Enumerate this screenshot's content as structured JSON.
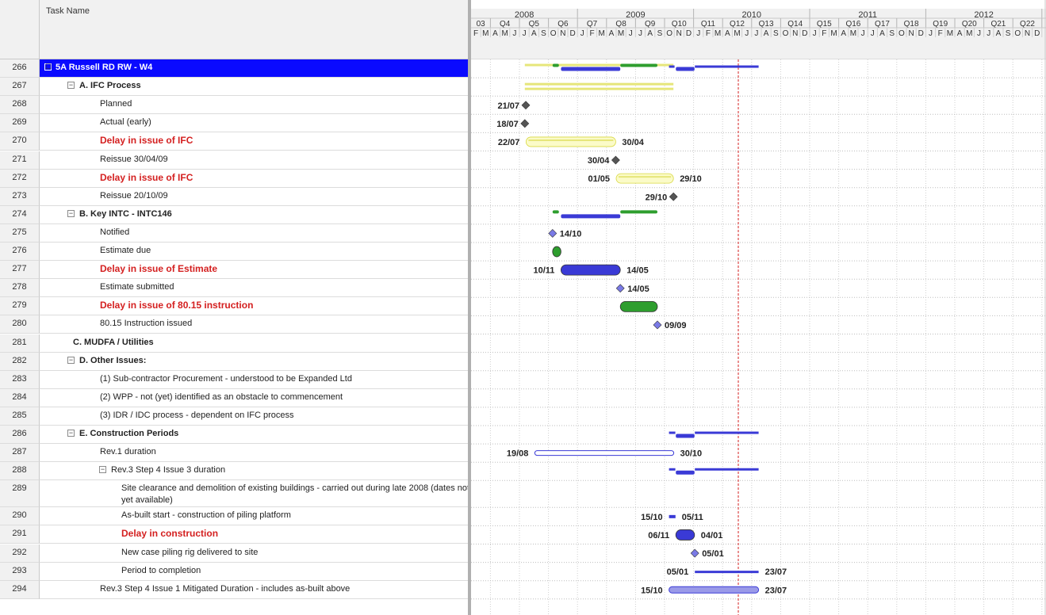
{
  "table": {
    "header": {
      "task_name": "Task Name"
    },
    "rows": [
      {
        "id": "266",
        "name": "5A Russell RD RW - W4",
        "style": "selected",
        "toggle": "☐"
      },
      {
        "id": "267",
        "name": "A. IFC Process",
        "style": "bold",
        "toggle": "−"
      },
      {
        "id": "268",
        "name": "Planned",
        "style": "normal"
      },
      {
        "id": "269",
        "name": "Actual (early)",
        "style": "normal"
      },
      {
        "id": "270",
        "name": "Delay in issue of IFC",
        "style": "red"
      },
      {
        "id": "271",
        "name": "Reissue 30/04/09",
        "style": "normal"
      },
      {
        "id": "272",
        "name": "Delay in issue of IFC",
        "style": "red"
      },
      {
        "id": "273",
        "name": "Reissue 20/10/09",
        "style": "normal"
      },
      {
        "id": "274",
        "name": "B. Key INTC - INTC146",
        "style": "bold",
        "toggle": "−"
      },
      {
        "id": "275",
        "name": "Notified",
        "style": "normal"
      },
      {
        "id": "276",
        "name": "Estimate due",
        "style": "normal"
      },
      {
        "id": "277",
        "name": "Delay in issue of Estimate",
        "style": "red"
      },
      {
        "id": "278",
        "name": "Estimate submitted",
        "style": "normal"
      },
      {
        "id": "279",
        "name": "Delay in issue of 80.15 instruction",
        "style": "red"
      },
      {
        "id": "280",
        "name": "80.15 Instruction issued",
        "style": "normal"
      },
      {
        "id": "281",
        "name": "C. MUDFA / Utilities",
        "style": "bold"
      },
      {
        "id": "282",
        "name": "D. Other Issues:",
        "style": "bold",
        "toggle": "−"
      },
      {
        "id": "283",
        "name": "(1) Sub-contractor Procurement - understood to be Expanded Ltd",
        "style": "normal"
      },
      {
        "id": "284",
        "name": "(2) WPP - not (yet) identified as an obstacle to commencement",
        "style": "normal"
      },
      {
        "id": "285",
        "name": "(3) IDR / IDC process - dependent on IFC process",
        "style": "normal"
      },
      {
        "id": "286",
        "name": "E. Construction Periods",
        "style": "bold",
        "toggle": "−"
      },
      {
        "id": "287",
        "name": "Rev.1 duration",
        "style": "normal"
      },
      {
        "id": "288",
        "name": "Rev.3 Step 4 Issue 3 duration",
        "style": "normal",
        "toggle": "−"
      },
      {
        "id": "289",
        "name": "Site clearance and demolition of existing buildings - carried out during late 2008 (dates not yet available)",
        "style": "wrap"
      },
      {
        "id": "290",
        "name": "As-built start - construction of piling platform",
        "style": "normal"
      },
      {
        "id": "291",
        "name": "Delay in construction",
        "style": "red"
      },
      {
        "id": "292",
        "name": "New case piling rig delivered to site",
        "style": "normal"
      },
      {
        "id": "293",
        "name": "Period to completion",
        "style": "normal"
      },
      {
        "id": "294",
        "name": "Rev.3 Step 4 Issue 1 Mitigated Duration - includes as-built above",
        "style": "normal"
      }
    ]
  },
  "timescale": {
    "years": [
      "2008",
      "2009",
      "2010",
      "2011",
      "2012"
    ],
    "quarters": [
      "Q3",
      "Q4",
      "Q5",
      "Q6",
      "Q7",
      "Q8",
      "Q9",
      "Q10",
      "Q11",
      "Q12",
      "Q13",
      "Q14",
      "Q15",
      "Q16",
      "Q17",
      "Q18",
      "Q19",
      "Q20",
      "Q21",
      "Q22"
    ],
    "first_quarter_display": "03",
    "month_letters": "FMAMJJASONDJFMAMJJASONDJFMAMJJASONDJFMAMJJASONDJFMAMJJASOND"
  },
  "colors": {
    "selected_row": "#0a0aff",
    "blue_bar": "#3a3ad6",
    "green_bar": "#2e9e2e",
    "yellow_bar": "#e6e67a",
    "milestone": "#555555",
    "milestone_blue": "#7a7ae6",
    "status_line": "#d42020",
    "delay_text": "#d42020"
  },
  "gantt": {
    "items": [
      {
        "row": 0,
        "kind": "summary-set"
      },
      {
        "row": 1,
        "kind": "summary-yellow"
      },
      {
        "row": 2,
        "kind": "milestone",
        "color": "dark",
        "date": "2008-07-21",
        "left_label": "21/07"
      },
      {
        "row": 3,
        "kind": "milestone",
        "color": "dark",
        "date": "2008-07-18",
        "left_label": "18/07"
      },
      {
        "row": 4,
        "kind": "bar",
        "color": "yellow",
        "start": "2008-07-22",
        "end": "2009-04-30",
        "left_label": "22/07",
        "right_label": "30/04"
      },
      {
        "row": 5,
        "kind": "milestone",
        "color": "dark",
        "date": "2009-04-30",
        "left_label": "30/04"
      },
      {
        "row": 6,
        "kind": "bar",
        "color": "yellow",
        "start": "2009-05-01",
        "end": "2009-10-29",
        "left_label": "01/05",
        "right_label": "29/10"
      },
      {
        "row": 7,
        "kind": "milestone",
        "color": "dark",
        "date": "2009-10-29",
        "left_label": "29/10"
      },
      {
        "row": 8,
        "kind": "summary-b"
      },
      {
        "row": 9,
        "kind": "milestone",
        "color": "blue",
        "date": "2008-10-14",
        "right_label": "14/10"
      },
      {
        "row": 10,
        "kind": "bar",
        "color": "green",
        "start": "2008-10-14",
        "end": "2008-11-10"
      },
      {
        "row": 11,
        "kind": "bar",
        "color": "blue",
        "start": "2008-11-10",
        "end": "2009-05-14",
        "left_label": "10/11",
        "right_label": "14/05"
      },
      {
        "row": 12,
        "kind": "milestone",
        "color": "blue",
        "date": "2009-05-14",
        "right_label": "14/05"
      },
      {
        "row": 13,
        "kind": "bar",
        "color": "green",
        "start": "2009-05-14",
        "end": "2009-09-09"
      },
      {
        "row": 14,
        "kind": "milestone",
        "color": "blue",
        "date": "2009-09-09",
        "right_label": "09/09"
      },
      {
        "row": 20,
        "kind": "summary-e"
      },
      {
        "row": 21,
        "kind": "outline-bar",
        "start": "2008-08-19",
        "end": "2009-10-30",
        "left_label": "19/08",
        "right_label": "30/10"
      },
      {
        "row": 22,
        "kind": "summary-e"
      },
      {
        "row": 24,
        "kind": "bar-thin",
        "color": "blue",
        "start": "2009-10-15",
        "end": "2009-11-05",
        "left_label": "15/10",
        "right_label": "05/11"
      },
      {
        "row": 25,
        "kind": "bar",
        "color": "blue",
        "start": "2009-11-06",
        "end": "2010-01-04",
        "left_label": "06/11",
        "right_label": "04/01"
      },
      {
        "row": 26,
        "kind": "milestone",
        "color": "blue",
        "date": "2010-01-05",
        "right_label": "05/01"
      },
      {
        "row": 27,
        "kind": "line-bar",
        "start": "2010-01-05",
        "end": "2010-07-23",
        "left_label": "05/01",
        "right_label": "23/07"
      },
      {
        "row": 28,
        "kind": "bar-mitigated",
        "start": "2009-10-15",
        "end": "2010-07-23",
        "left_label": "15/10",
        "right_label": "23/07"
      }
    ]
  }
}
